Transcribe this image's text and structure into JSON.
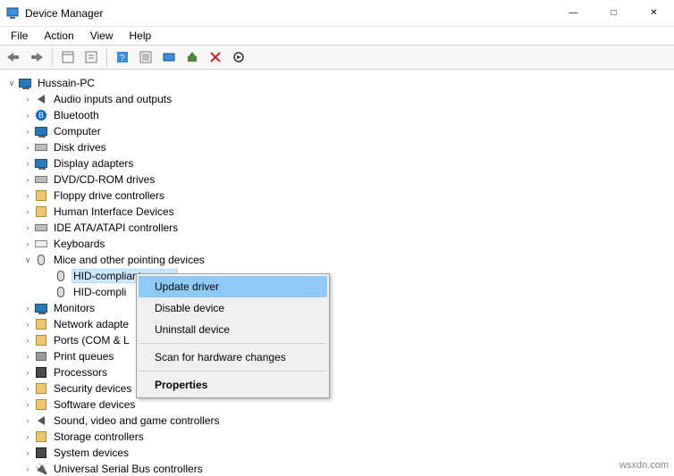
{
  "window": {
    "title": "Device Manager"
  },
  "menubar": [
    "File",
    "Action",
    "View",
    "Help"
  ],
  "tree": {
    "root": "Hussain-PC",
    "categories": [
      {
        "label": "Audio inputs and outputs",
        "icon": "speaker-icon",
        "expanded": false
      },
      {
        "label": "Bluetooth",
        "icon": "bluetooth-icon",
        "expanded": false
      },
      {
        "label": "Computer",
        "icon": "computer-icon",
        "expanded": false
      },
      {
        "label": "Disk drives",
        "icon": "disk-icon",
        "expanded": false
      },
      {
        "label": "Display adapters",
        "icon": "monitor-icon",
        "expanded": false
      },
      {
        "label": "DVD/CD-ROM drives",
        "icon": "optical-icon",
        "expanded": false
      },
      {
        "label": "Floppy drive controllers",
        "icon": "floppy-icon",
        "expanded": false
      },
      {
        "label": "Human Interface Devices",
        "icon": "hid-icon",
        "expanded": false
      },
      {
        "label": "IDE ATA/ATAPI controllers",
        "icon": "ide-icon",
        "expanded": false
      },
      {
        "label": "Keyboards",
        "icon": "keyboard-icon",
        "expanded": false
      },
      {
        "label": "Mice and other pointing devices",
        "icon": "mouse-icon",
        "expanded": true,
        "children": [
          {
            "label": "HID-compliant mouse",
            "icon": "mouse-icon",
            "selected": true
          },
          {
            "label": "HID-compli",
            "icon": "mouse-icon",
            "truncated": true
          }
        ]
      },
      {
        "label": "Monitors",
        "icon": "monitor-icon",
        "expanded": false
      },
      {
        "label": "Network adapte",
        "icon": "network-icon",
        "expanded": false,
        "truncated": true
      },
      {
        "label": "Ports (COM & L",
        "icon": "port-icon",
        "expanded": false,
        "truncated": true
      },
      {
        "label": "Print queues",
        "icon": "printer-icon",
        "expanded": false
      },
      {
        "label": "Processors",
        "icon": "cpu-icon",
        "expanded": false
      },
      {
        "label": "Security devices",
        "icon": "security-icon",
        "expanded": false
      },
      {
        "label": "Software devices",
        "icon": "software-icon",
        "expanded": false
      },
      {
        "label": "Sound, video and game controllers",
        "icon": "sound-icon",
        "expanded": false
      },
      {
        "label": "Storage controllers",
        "icon": "storage-icon",
        "expanded": false
      },
      {
        "label": "System devices",
        "icon": "system-icon",
        "expanded": false
      },
      {
        "label": "Universal Serial Bus controllers",
        "icon": "usb-icon",
        "expanded": false
      }
    ]
  },
  "context_menu": {
    "items": [
      {
        "label": "Update driver",
        "highlighted": true
      },
      {
        "label": "Disable device"
      },
      {
        "label": "Uninstall device"
      },
      {
        "separator": true
      },
      {
        "label": "Scan for hardware changes"
      },
      {
        "separator": true
      },
      {
        "label": "Properties",
        "bold": true
      }
    ]
  },
  "watermark": "wsxdn.com"
}
